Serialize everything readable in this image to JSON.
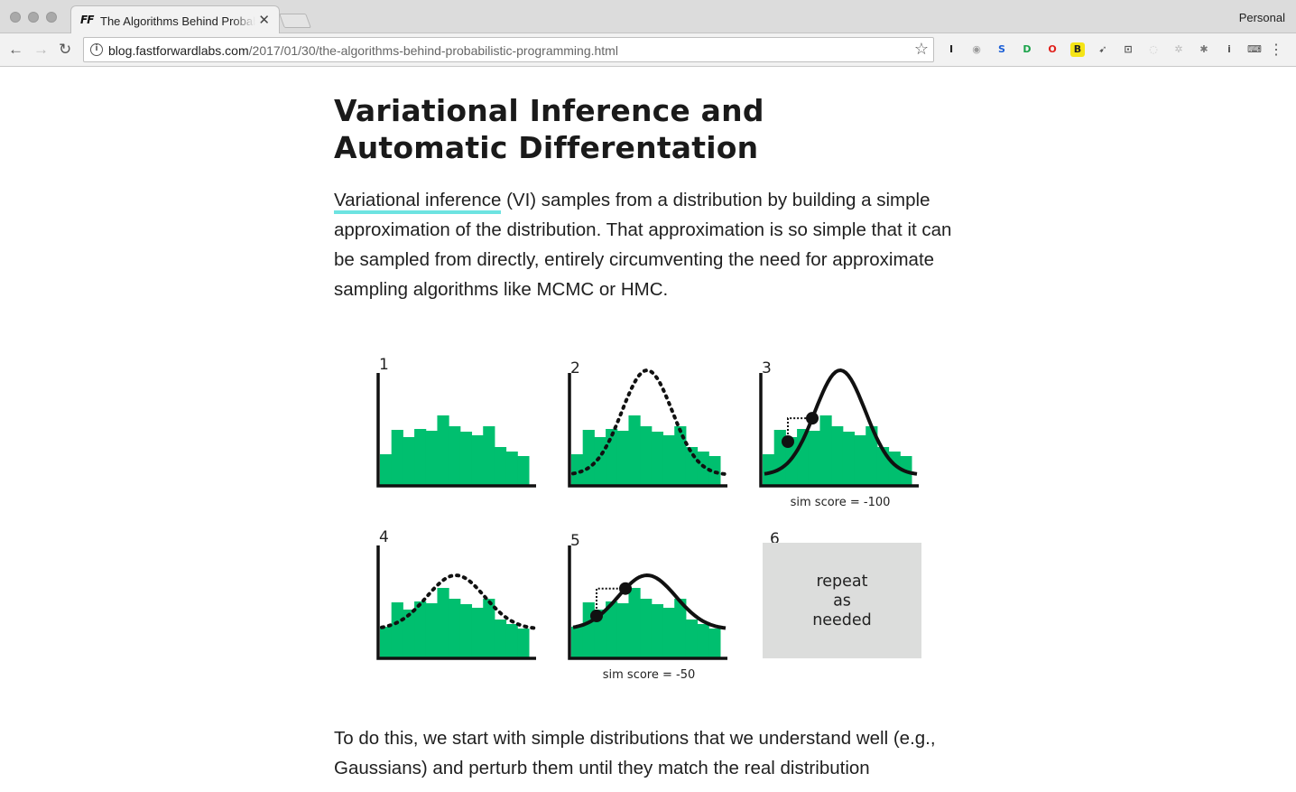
{
  "browser": {
    "tab_title": "The Algorithms Behind Probabilistic Programming",
    "tab_favicon": "FF",
    "profile": "Personal",
    "url_host": "blog.fastforwardlabs.com",
    "url_path": "/2017/01/30/the-algorithms-behind-probabilistic-programming.html",
    "extensions": [
      {
        "icon": "instapaper-icon",
        "glyph": "I",
        "color": "#222222"
      },
      {
        "icon": "camera-icon",
        "glyph": "◉",
        "color": "#9a9a9a"
      },
      {
        "icon": "lastpass-icon",
        "glyph": "S",
        "color": "#1c5fd6"
      },
      {
        "icon": "evernote-icon",
        "glyph": "D",
        "color": "#1aa34a"
      },
      {
        "icon": "opera-icon",
        "glyph": "O",
        "color": "#e0201b"
      },
      {
        "icon": "bookmarklet-icon",
        "glyph": "B",
        "color": "#222222"
      },
      {
        "icon": "pin-icon",
        "glyph": "➹",
        "color": "#555555"
      },
      {
        "icon": "cast-icon",
        "glyph": "⊡",
        "color": "#555555"
      },
      {
        "icon": "disabled-extension-icon",
        "glyph": "◌",
        "color": "#c9c9c9"
      },
      {
        "icon": "gear-extension-icon",
        "glyph": "✲",
        "color": "#bbbbbb"
      },
      {
        "icon": "bug-icon",
        "glyph": "✱",
        "color": "#777777"
      },
      {
        "icon": "info-box-icon",
        "glyph": "i",
        "color": "#555555"
      },
      {
        "icon": "keyboard-icon",
        "glyph": "⌨",
        "color": "#444444"
      }
    ]
  },
  "article": {
    "heading": "Variational Inference and Automatic Differentation",
    "para1_link": "Variational inference",
    "para1_rest": " (VI) samples from a distribution by building a simple approximation of the distribution. That approximation is so simple that it can be sampled from directly, entirely circumventing the need for approximate sampling algorithms like MCMC or HMC.",
    "para2": "To do this, we start with simple distributions that we understand well (e.g., Gaussians) and perturb them until they match the real distribution"
  },
  "figure": {
    "panels": [
      {
        "number": "1",
        "curve": "none",
        "caption": ""
      },
      {
        "number": "2",
        "curve": "dotted",
        "caption": ""
      },
      {
        "number": "3",
        "curve": "solid",
        "caption": "sim score = -100"
      },
      {
        "number": "4",
        "curve": "dotted",
        "caption": ""
      },
      {
        "number": "5",
        "curve": "solid",
        "caption": "sim score = -50"
      },
      {
        "number": "6",
        "curve": "none",
        "caption": ""
      }
    ],
    "histogram_values": [
      0.35,
      0.62,
      0.54,
      0.63,
      0.61,
      0.78,
      0.66,
      0.6,
      0.56,
      0.66,
      0.43,
      0.38,
      0.33
    ],
    "repeat_lines": [
      "repeat",
      "as",
      "needed"
    ],
    "colors": {
      "bars": "#00bf6f",
      "axis": "#111111",
      "repeat_box": "#dcdddc"
    }
  }
}
